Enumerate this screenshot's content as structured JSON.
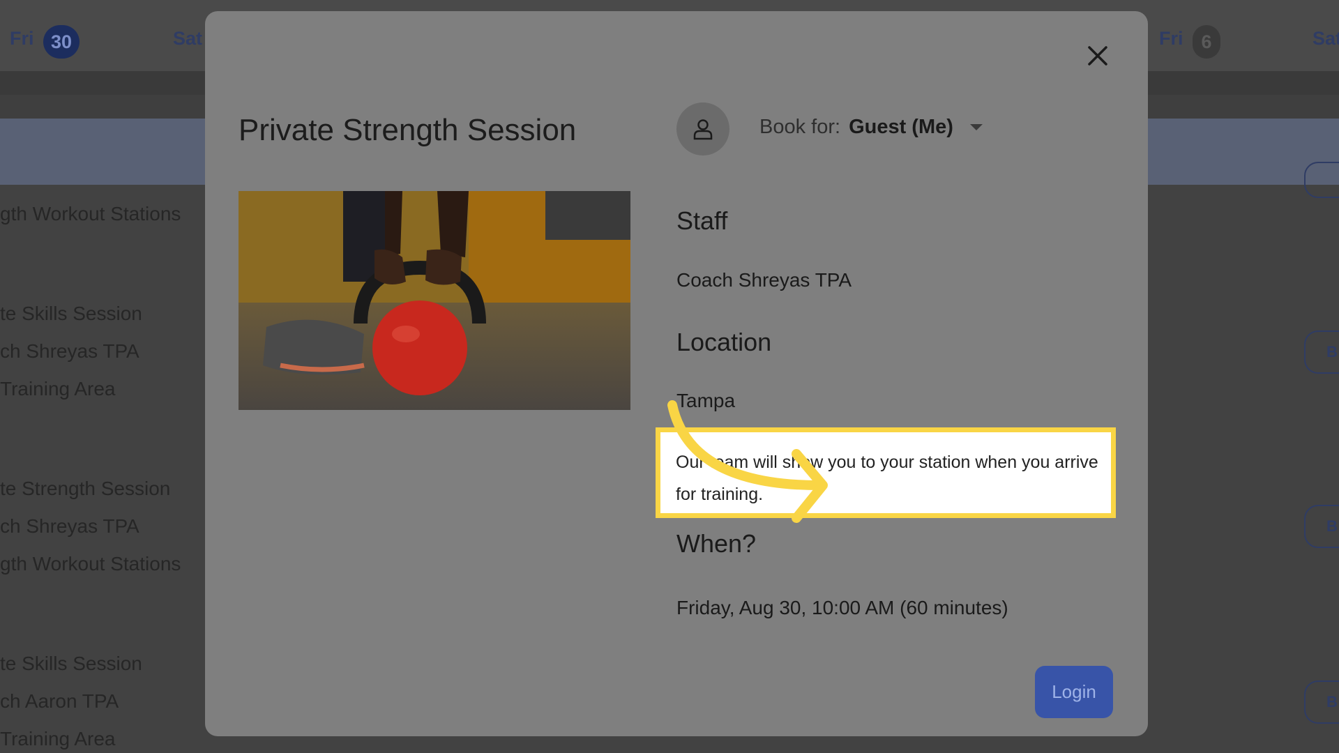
{
  "background": {
    "days": [
      {
        "label": "Fri",
        "badge": "30"
      },
      {
        "label": "Sat"
      },
      {
        "label": "Fri",
        "badge": "6"
      },
      {
        "label": "Sat"
      }
    ],
    "list_lines": [
      "gth Workout Stations",
      "te Skills Session",
      "ch Shreyas TPA",
      " Training Area",
      "te Strength Session",
      "ch Shreyas TPA",
      "gth Workout Stations",
      "te Skills Session",
      "ch Aaron TPA",
      " Training Area"
    ],
    "book_button_label": "B"
  },
  "modal": {
    "title": "Private Strength Session",
    "book_for": {
      "label": "Book for:",
      "value": "Guest (Me)"
    },
    "staff": {
      "heading": "Staff",
      "value": "Coach Shreyas TPA"
    },
    "location": {
      "heading": "Location",
      "value": "Tampa",
      "note": "Our team will show you to your station when you arrive for training."
    },
    "when": {
      "heading": "When?",
      "value": "Friday, Aug 30, 10:00 AM (60 minutes)"
    },
    "login_label": "Login"
  },
  "colors": {
    "highlight_border": "#f9d545",
    "arrow": "#f9d545",
    "login_button": "#3854a8"
  },
  "icons": [
    "close-icon",
    "user-icon",
    "chevron-down-icon",
    "arrow-icon"
  ]
}
